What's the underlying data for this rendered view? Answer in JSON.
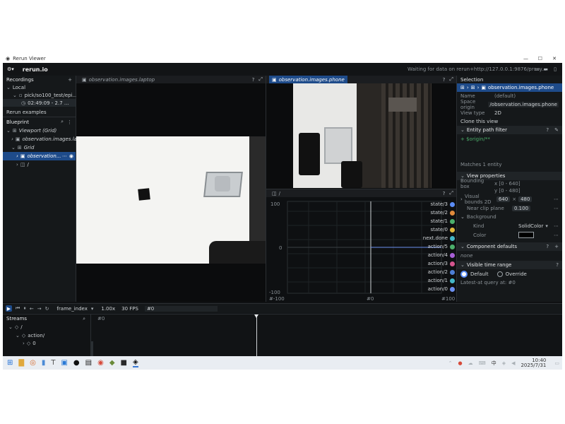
{
  "window": {
    "title": "Rerun Viewer",
    "app_name": "rerun.io",
    "status": "Waiting for data on rerun+http://127.0.0.1:9876/proxy..."
  },
  "left": {
    "recordings_label": "Recordings",
    "local_label": "Local",
    "recording_name": "pick/so100_test/epi...",
    "recording_time": "02:49:09 - 2.7 ...",
    "examples_label": "Rerun examples",
    "blueprint_label": "Blueprint",
    "viewport_label": "Viewport (Grid)",
    "tree": [
      {
        "label": "observation.images.la..."
      },
      {
        "label": "Grid"
      },
      {
        "label": "observation..."
      },
      {
        "label": "/"
      }
    ]
  },
  "views": {
    "laptop_title": "observation.images.laptop",
    "phone_title": "observation.images.phone",
    "plot_title": "/"
  },
  "plot": {
    "y_ticks": [
      "100",
      "0",
      "-100"
    ],
    "x_ticks": [
      "#-100",
      "#0",
      "#100"
    ],
    "legend": [
      {
        "name": "state/3",
        "color": "#5b8df6"
      },
      {
        "name": "state/2",
        "color": "#e08a3c"
      },
      {
        "name": "state/1",
        "color": "#4caf6b"
      },
      {
        "name": "state/0",
        "color": "#e0b83c"
      },
      {
        "name": "next.done",
        "color": "#45b7c8"
      },
      {
        "name": "action/5",
        "color": "#4caf6b"
      },
      {
        "name": "action/4",
        "color": "#a85fd6"
      },
      {
        "name": "action/3",
        "color": "#d6558f"
      },
      {
        "name": "action/2",
        "color": "#4d7fd6"
      },
      {
        "name": "action/1",
        "color": "#45b7c8"
      },
      {
        "name": "action/0",
        "color": "#6c8ff0"
      }
    ]
  },
  "selection": {
    "title": "Selection",
    "crumb": "observation.images.phone",
    "name_label": "Name",
    "name_value": "(default)",
    "origin_label": "Space origin",
    "origin_value": "/observation.images.phone",
    "type_label": "View type",
    "type_value": "2D",
    "clone_label": "Clone this view",
    "filter_label": "Entity path filter",
    "filter_value": "+ $origin/**",
    "matches": "Matches 1 entity",
    "props_label": "View properties",
    "bbox_label": "Bounding box",
    "bbox_x": "x [0 - 640]",
    "bbox_y": "y [0 - 480]",
    "visual_bounds_label": "Visual bounds 2D",
    "visual_bounds_w": "640",
    "visual_bounds_h": "480",
    "near_clip_label": "Near clip plane",
    "near_clip_value": "0.100",
    "background_label": "Background",
    "kind_label": "Kind",
    "kind_value": "SolidColor",
    "color_label": "Color",
    "component_defaults_label": "Component defaults",
    "none_label": "none",
    "visible_time_label": "Visible time range",
    "default_option": "Default",
    "override_option": "Override",
    "latest_label": "Latest-at query at: #0"
  },
  "timeline": {
    "timeline_name": "frame_index",
    "speed": "1.00x",
    "fps": "30 FPS",
    "frame": "#0",
    "marker": "#0"
  },
  "streams": {
    "label": "Streams",
    "items": [
      "/",
      "action/",
      "0"
    ]
  },
  "taskbar": {
    "time": "10:40",
    "date": "2025/7/31",
    "lang": "中"
  }
}
